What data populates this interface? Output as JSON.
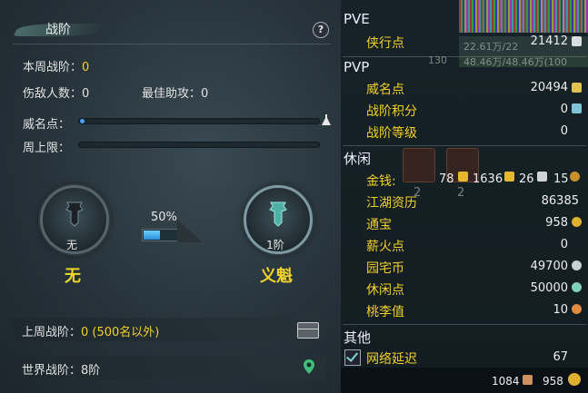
{
  "left": {
    "title": "战阶",
    "help": "?",
    "week_rank_label": "本周战阶：",
    "week_rank_value": "0",
    "kills_label": "伤敌人数：",
    "kills_value": "0",
    "assist_label": "最佳助攻：",
    "assist_value": "0",
    "fame_label": "威名点：",
    "week_limit_label": "周上限：",
    "progress_percent": "50%",
    "progress_fraction": 0.5,
    "current_rank": {
      "caption": "无",
      "name": "无"
    },
    "next_rank": {
      "caption": "1阶",
      "name": "义魁"
    },
    "last_week_label": "上周战阶：",
    "last_week_value": "0 (500名以外)",
    "world_rank_label": "世界战阶：",
    "world_rank_value": "8阶"
  },
  "right": {
    "bg_top_text": "22.61万/22",
    "bg_mid_text": "48.46万/48.46万(100",
    "bg_level": "130",
    "bg_slot_num_1": "2",
    "bg_slot_num_2": "2",
    "pve": {
      "title": "PVE",
      "items": [
        {
          "label": "侠行点",
          "value": "21412"
        }
      ]
    },
    "pvp": {
      "title": "PVP",
      "items": [
        {
          "label": "威名点",
          "value": "20494"
        },
        {
          "label": "战阶积分",
          "value": "0"
        },
        {
          "label": "战阶等级",
          "value": "0"
        }
      ]
    },
    "leisure": {
      "title": "休闲",
      "money_label": "金钱:",
      "money": [
        "78",
        "1636",
        "26",
        "15"
      ],
      "items": [
        {
          "label": "江湖资历",
          "value": "86385"
        },
        {
          "label": "通宝",
          "value": "958"
        },
        {
          "label": "薪火点",
          "value": "0"
        },
        {
          "label": "园宅币",
          "value": "49700"
        },
        {
          "label": "休闲点",
          "value": "50000"
        },
        {
          "label": "桃李值",
          "value": "10"
        }
      ]
    },
    "other": {
      "title": "其他",
      "items": [
        {
          "label": "网络延迟",
          "value": "67"
        }
      ]
    },
    "footer": {
      "value1": "1084",
      "value2": "958"
    }
  },
  "colors": {
    "accent_yellow": "#f2d02a",
    "progress_blue": "#2a8fd8"
  }
}
